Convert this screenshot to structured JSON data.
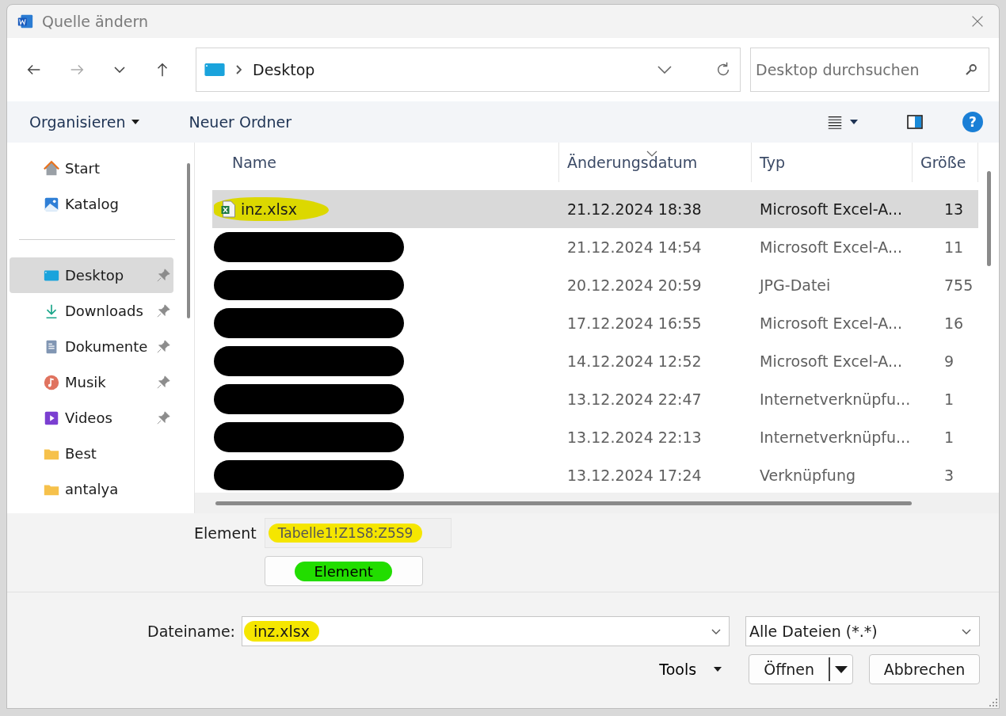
{
  "window": {
    "title": "Quelle ändern"
  },
  "address": {
    "path": "Desktop"
  },
  "search": {
    "placeholder": "Desktop durchsuchen"
  },
  "toolbar": {
    "organize": "Organisieren",
    "new_folder": "Neuer Ordner",
    "help": "?"
  },
  "sidebar": {
    "sections": [
      {
        "items": [
          {
            "label": "Start",
            "kind": "home",
            "pinned": false,
            "selected": false
          },
          {
            "label": "Katalog",
            "kind": "gallery",
            "pinned": false,
            "selected": false
          }
        ]
      },
      {
        "items": [
          {
            "label": "Desktop",
            "kind": "desktop",
            "pinned": true,
            "selected": true
          },
          {
            "label": "Downloads",
            "kind": "download",
            "pinned": true,
            "selected": false
          },
          {
            "label": "Dokumente",
            "kind": "document",
            "pinned": true,
            "selected": false
          },
          {
            "label": "Musik",
            "kind": "music",
            "pinned": true,
            "selected": false
          },
          {
            "label": "Videos",
            "kind": "video",
            "pinned": true,
            "selected": false
          },
          {
            "label": "Best",
            "kind": "folder",
            "pinned": false,
            "selected": false
          },
          {
            "label": "antalya",
            "kind": "folder",
            "pinned": false,
            "selected": false
          }
        ]
      }
    ]
  },
  "table": {
    "columns": [
      {
        "label": "Name",
        "sorted": false
      },
      {
        "label": "Änderungsdatum",
        "sorted": true
      },
      {
        "label": "Typ",
        "sorted": false
      },
      {
        "label": "Größe",
        "sorted": false
      }
    ],
    "rows": [
      {
        "name": "inz.xlsx",
        "redacted": false,
        "highlighted": true,
        "date": "21.12.2024 18:38",
        "type": "Microsoft Excel-A...",
        "size": "13",
        "selected": true
      },
      {
        "redacted": true,
        "highlighted": false,
        "date": "21.12.2024 14:54",
        "type": "Microsoft Excel-A...",
        "size": "11",
        "selected": false
      },
      {
        "redacted": true,
        "highlighted": false,
        "date": "20.12.2024 20:59",
        "type": "JPG-Datei",
        "size": "755",
        "selected": false
      },
      {
        "redacted": true,
        "highlighted": false,
        "date": "17.12.2024 16:55",
        "type": "Microsoft Excel-A...",
        "size": "16",
        "selected": false
      },
      {
        "redacted": true,
        "highlighted": false,
        "date": "14.12.2024 12:52",
        "type": "Microsoft Excel-A...",
        "size": "9",
        "selected": false
      },
      {
        "redacted": true,
        "highlighted": false,
        "date": "13.12.2024 22:47",
        "type": "Internetverknüpfu...",
        "size": "1",
        "selected": false
      },
      {
        "redacted": true,
        "highlighted": false,
        "date": "13.12.2024 22:13",
        "type": "Internetverknüpfu...",
        "size": "1",
        "selected": false
      },
      {
        "redacted": true,
        "highlighted": false,
        "date": "13.12.2024 17:24",
        "type": "Verknüpfung",
        "size": "3",
        "selected": false
      }
    ]
  },
  "element": {
    "label": "Element",
    "value": "Tabelle1!Z1S8:Z5S9",
    "disabled": true,
    "highlighted": true,
    "button": {
      "label": "Element",
      "highlighted": true
    }
  },
  "filename": {
    "label": "Dateiname:",
    "value": "inz.xlsx",
    "highlighted": true
  },
  "filetype": {
    "value": "Alle Dateien (*.*)"
  },
  "buttons": {
    "tools": "Tools",
    "open": "Öffnen",
    "cancel": "Abbrechen"
  }
}
